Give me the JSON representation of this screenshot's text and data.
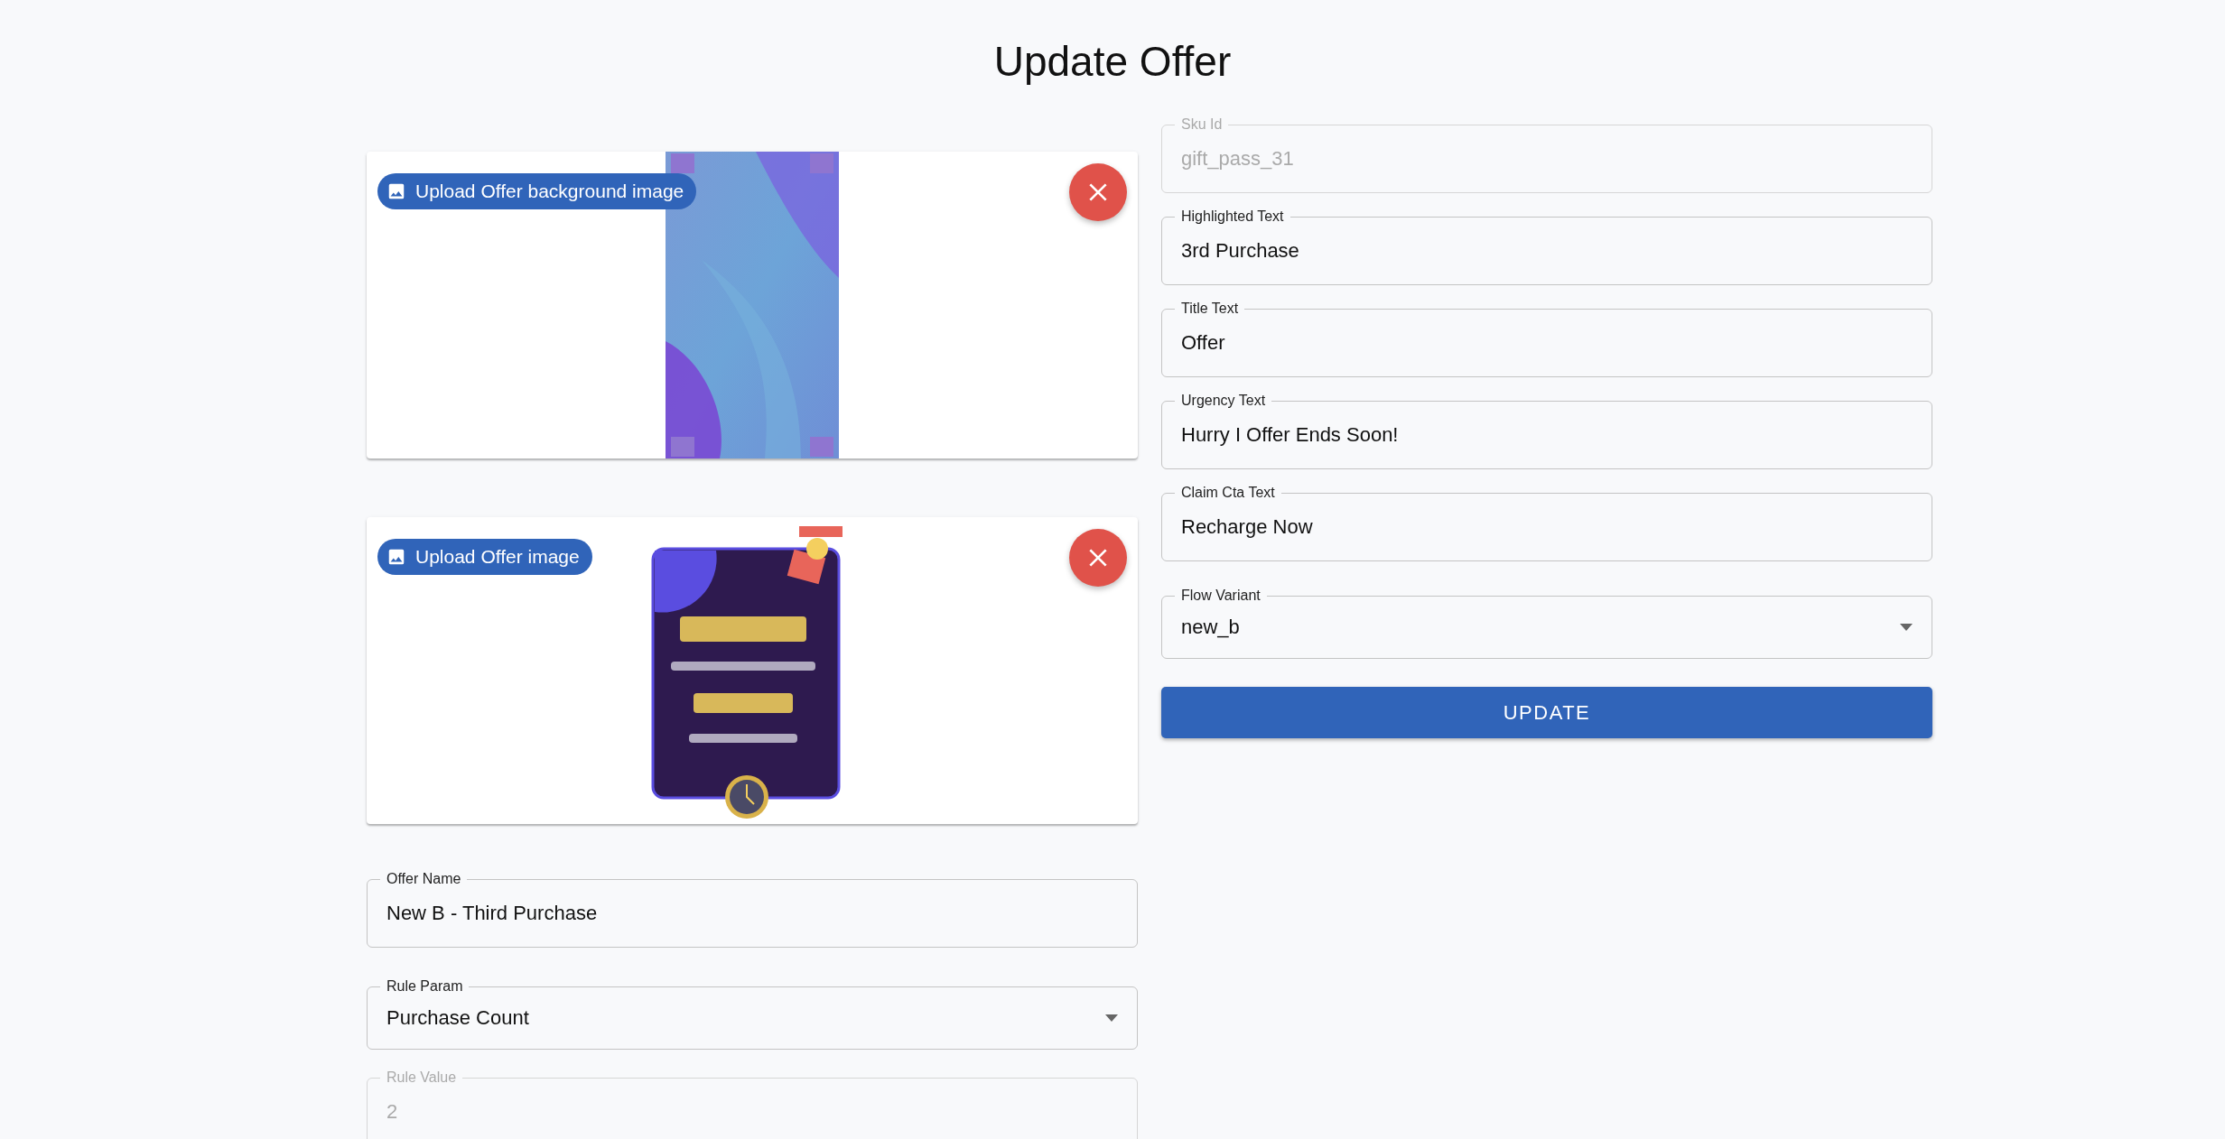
{
  "title": "Update Offer",
  "uploads": [
    {
      "label": "Upload Offer background image"
    },
    {
      "label": "Upload Offer image"
    }
  ],
  "left_fields": [
    {
      "kind": "text",
      "label": "Offer Name",
      "value": "New B - Third Purchase",
      "disabled": false
    },
    {
      "kind": "select",
      "label": "Rule Param",
      "value": "Purchase Count",
      "disabled": false
    },
    {
      "kind": "text",
      "label": "Rule Value",
      "value": "2",
      "disabled": true
    }
  ],
  "right_fields": [
    {
      "kind": "text",
      "label": "Sku Id",
      "value": "gift_pass_31",
      "disabled": true
    },
    {
      "kind": "text",
      "label": "Highlighted Text",
      "value": "3rd Purchase",
      "disabled": false
    },
    {
      "kind": "text",
      "label": "Title Text",
      "value": "Offer",
      "disabled": false
    },
    {
      "kind": "text",
      "label": "Urgency Text",
      "value": "Hurry I Offer Ends Soon!",
      "disabled": false
    },
    {
      "kind": "text",
      "label": "Claim Cta Text",
      "value": "Recharge Now",
      "disabled": false
    },
    {
      "kind": "select",
      "label": "Flow Variant",
      "value": "new_b",
      "disabled": false
    }
  ],
  "submit_button": "UPDATE"
}
